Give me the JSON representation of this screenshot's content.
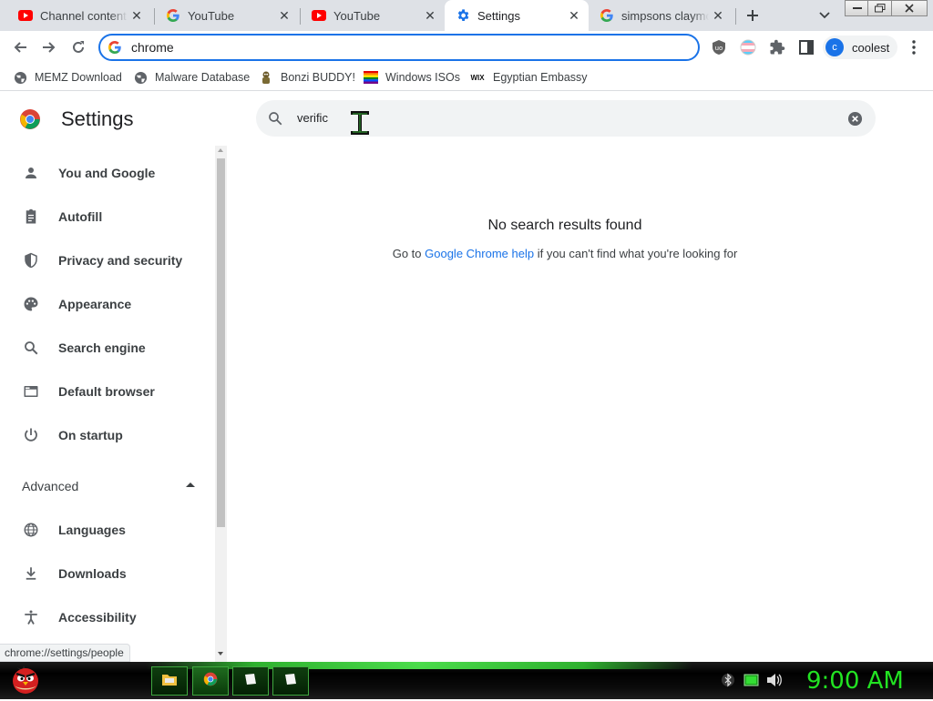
{
  "tabs": [
    {
      "title": "Channel content -",
      "favicon": "youtube-icon",
      "active": false
    },
    {
      "title": "YouTube",
      "favicon": "google-icon",
      "active": false
    },
    {
      "title": "YouTube",
      "favicon": "youtube-icon",
      "active": false
    },
    {
      "title": "Settings",
      "favicon": "gear-icon",
      "active": true
    },
    {
      "title": "simpsons claymo",
      "favicon": "google-icon",
      "active": false
    }
  ],
  "omnibox": {
    "value": "chrome"
  },
  "profile": {
    "initial": "c",
    "name": "coolest"
  },
  "bookmarks": [
    {
      "label": "MEMZ Download",
      "icon": "globe-icon"
    },
    {
      "label": "Malware Database",
      "icon": "globe-icon"
    },
    {
      "label": "Bonzi BUDDY!",
      "icon": "bonzi-icon"
    },
    {
      "label": "Windows ISOs",
      "icon": "rainbow-flag-icon"
    },
    {
      "label": "Egyptian Embassy",
      "icon": "wix-icon",
      "icon_text": "WIX"
    }
  ],
  "settings": {
    "title": "Settings",
    "search_query": "verific",
    "nav": [
      {
        "label": "You and Google",
        "icon": "person-icon"
      },
      {
        "label": "Autofill",
        "icon": "clipboard-icon"
      },
      {
        "label": "Privacy and security",
        "icon": "shield-icon"
      },
      {
        "label": "Appearance",
        "icon": "palette-icon"
      },
      {
        "label": "Search engine",
        "icon": "search-icon"
      },
      {
        "label": "Default browser",
        "icon": "browser-icon"
      },
      {
        "label": "On startup",
        "icon": "power-icon"
      }
    ],
    "advanced_label": "Advanced",
    "advanced_nav": [
      {
        "label": "Languages",
        "icon": "globe-icon"
      },
      {
        "label": "Downloads",
        "icon": "download-icon"
      },
      {
        "label": "Accessibility",
        "icon": "accessibility-icon"
      }
    ],
    "no_results": "No search results found",
    "help_prefix": "Go to ",
    "help_link": "Google Chrome help",
    "help_suffix": " if you can't find what you're looking for"
  },
  "status_url": "chrome://settings/people",
  "taskbar": {
    "clock": "9:00 AM"
  },
  "colors": {
    "accent": "#1a73e8",
    "clock": "#22e322"
  }
}
